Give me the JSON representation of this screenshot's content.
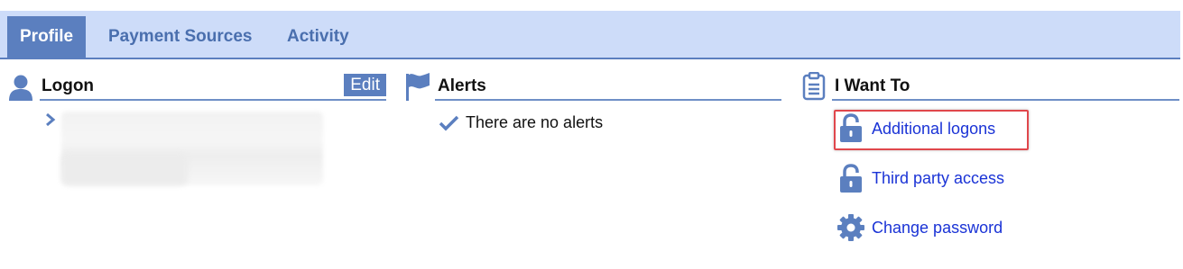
{
  "tabs": [
    {
      "label": "Profile",
      "active": true
    },
    {
      "label": "Payment Sources",
      "active": false
    },
    {
      "label": "Activity",
      "active": false
    }
  ],
  "logon": {
    "title": "Logon",
    "edit_label": "Edit",
    "icon": "user-icon",
    "expand_icon": "chevron-right-icon"
  },
  "alerts": {
    "title": "Alerts",
    "icon": "flag-icon",
    "message": "There are no alerts",
    "message_icon": "checkmark-icon"
  },
  "i_want_to": {
    "title": "I Want To",
    "icon": "clipboard-icon",
    "actions": [
      {
        "label": "Additional logons",
        "icon": "lock-icon",
        "highlighted": true
      },
      {
        "label": "Third party access",
        "icon": "lock-icon",
        "highlighted": false
      },
      {
        "label": "Change password",
        "icon": "gear-icon",
        "highlighted": false
      }
    ]
  },
  "colors": {
    "tabbar_bg": "#cddcf9",
    "accent": "#5b7fbf",
    "link": "#1a33d6",
    "highlight_border": "#e0474c"
  }
}
